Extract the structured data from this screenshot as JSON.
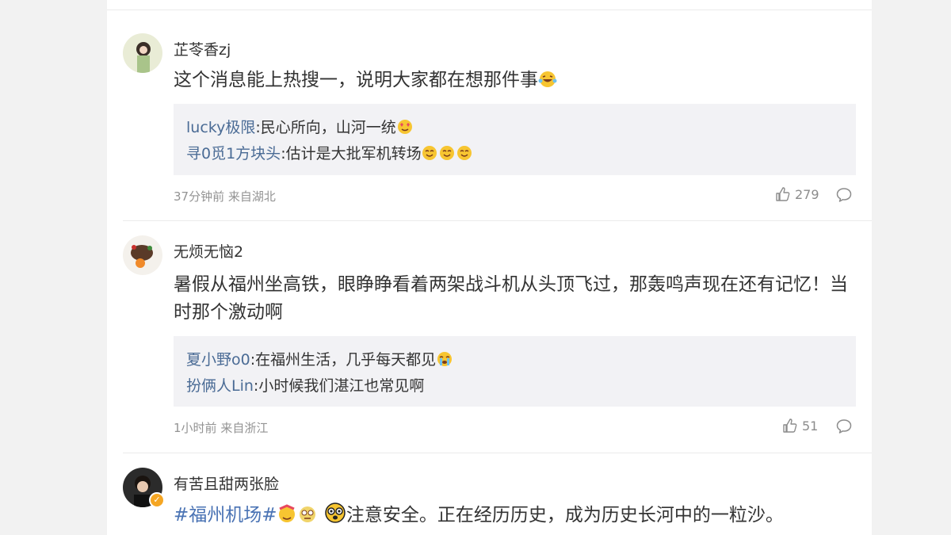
{
  "comments": [
    {
      "username": "芷苓香zj",
      "text": "这个消息能上热搜一，说明大家都在想那件事",
      "replies": [
        {
          "name": "lucky极限",
          "text": ":民心所向，山河一统"
        },
        {
          "name": "寻0觅1方块头",
          "text": ":估计是大批军机转场"
        }
      ],
      "time": "37分钟前",
      "location": "来自湖北",
      "likes": "279"
    },
    {
      "username": "无烦无恼2",
      "text": "暑假从福州坐高铁，眼睁睁看着两架战斗机从头顶飞过，那轰鸣声现在还有记忆！当时那个激动啊",
      "replies": [
        {
          "name": "夏小野o0",
          "text": ":在福州生活，几乎每天都见"
        },
        {
          "name": "扮俩人Lin",
          "text": ":小时候我们湛江也常见啊"
        }
      ],
      "time": "1小时前",
      "location": "来自浙江",
      "likes": "51"
    },
    {
      "username": "有苦且甜两张脸",
      "hashtag": "#福州机场#",
      "text": "注意安全。正在经历历史，成为历史长河中的一粒沙。"
    }
  ],
  "icons": {
    "like": "thumbs-up-icon",
    "comment": "comment-bubble-icon",
    "verified": "verified-badge-icon"
  },
  "colors": {
    "link": "#4a6b95",
    "hashtag": "#4a73b4",
    "meta": "#939393",
    "reply_bg": "#f2f2f5",
    "verified": "#f5a623"
  }
}
